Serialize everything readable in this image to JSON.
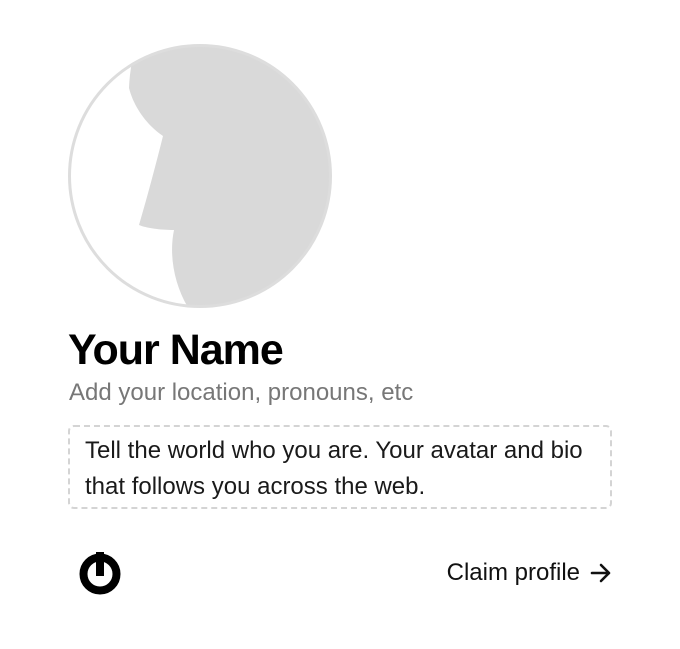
{
  "profile": {
    "name": "Your Name",
    "meta_placeholder": "Add your location, pronouns, etc",
    "bio_placeholder": "Tell the world who you are. Your avatar and bio that follows you across the web.",
    "avatar_icon": "default-avatar-silhouette",
    "avatar_fill": "#d9d9d9",
    "avatar_outline": "#dddddd"
  },
  "footer": {
    "logo_icon": "power-icon",
    "claim_label": "Claim profile",
    "claim_icon": "arrow-right-icon"
  }
}
